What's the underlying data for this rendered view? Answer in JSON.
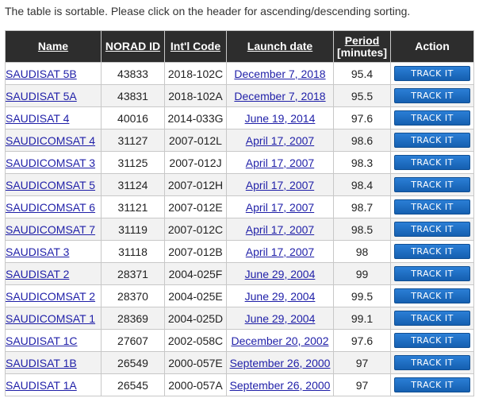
{
  "note": "The table is sortable. Please click on the header for ascending/descending sorting.",
  "headers": {
    "name": "Name",
    "norad": "NORAD ID",
    "intl": "Int'l Code",
    "launch": "Launch date",
    "period": "Period",
    "period_unit": "[minutes]",
    "action": "Action"
  },
  "button_label": "TRACK IT",
  "colors": {
    "header_bg": "#2d2d2d",
    "link": "#1f1fa8",
    "button": "#1f6fc5"
  },
  "rows": [
    {
      "name": "SAUDISAT 5B",
      "norad": "43833",
      "intl": "2018-102C",
      "launch": "December 7, 2018",
      "period": "95.4"
    },
    {
      "name": "SAUDISAT 5A",
      "norad": "43831",
      "intl": "2018-102A",
      "launch": "December 7, 2018",
      "period": "95.5"
    },
    {
      "name": "SAUDISAT 4",
      "norad": "40016",
      "intl": "2014-033G",
      "launch": "June 19, 2014",
      "period": "97.6"
    },
    {
      "name": "SAUDICOMSAT 4",
      "norad": "31127",
      "intl": "2007-012L",
      "launch": "April 17, 2007",
      "period": "98.6"
    },
    {
      "name": "SAUDICOMSAT 3",
      "norad": "31125",
      "intl": "2007-012J",
      "launch": "April 17, 2007",
      "period": "98.3"
    },
    {
      "name": "SAUDICOMSAT 5",
      "norad": "31124",
      "intl": "2007-012H",
      "launch": "April 17, 2007",
      "period": "98.4"
    },
    {
      "name": "SAUDICOMSAT 6",
      "norad": "31121",
      "intl": "2007-012E",
      "launch": "April 17, 2007",
      "period": "98.7"
    },
    {
      "name": "SAUDICOMSAT 7",
      "norad": "31119",
      "intl": "2007-012C",
      "launch": "April 17, 2007",
      "period": "98.5"
    },
    {
      "name": "SAUDISAT 3",
      "norad": "31118",
      "intl": "2007-012B",
      "launch": "April 17, 2007",
      "period": "98"
    },
    {
      "name": "SAUDISAT 2",
      "norad": "28371",
      "intl": "2004-025F",
      "launch": "June 29, 2004",
      "period": "99"
    },
    {
      "name": "SAUDICOMSAT 2",
      "norad": "28370",
      "intl": "2004-025E",
      "launch": "June 29, 2004",
      "period": "99.5"
    },
    {
      "name": "SAUDICOMSAT 1",
      "norad": "28369",
      "intl": "2004-025D",
      "launch": "June 29, 2004",
      "period": "99.1"
    },
    {
      "name": "SAUDISAT 1C",
      "norad": "27607",
      "intl": "2002-058C",
      "launch": "December 20, 2002",
      "period": "97.6"
    },
    {
      "name": "SAUDISAT 1B",
      "norad": "26549",
      "intl": "2000-057E",
      "launch": "September 26, 2000",
      "period": "97"
    },
    {
      "name": "SAUDISAT 1A",
      "norad": "26545",
      "intl": "2000-057A",
      "launch": "September 26, 2000",
      "period": "97"
    }
  ]
}
